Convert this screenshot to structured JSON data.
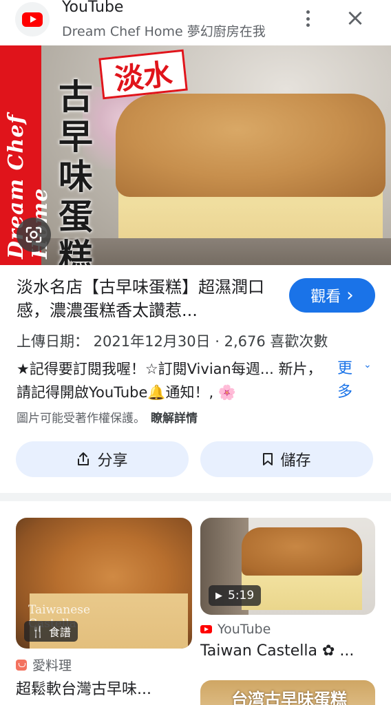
{
  "header": {
    "app_name": "YouTube",
    "channel": "Dream Chef Home 夢幻廚房在我",
    "icons": [
      "youtube-logo-icon",
      "more-vert-icon",
      "close-icon"
    ],
    "close_glyph": "×"
  },
  "hero": {
    "vertical_brand": "Dream Chef Home",
    "stamp": "淡水",
    "overlay_title": "古早味蛋糕",
    "lens_icon": "lens-icon"
  },
  "video": {
    "title": "淡水名店【古早味蛋糕】超濕潤口感，濃濃蛋糕香太讚惹...",
    "watch_label": "觀看",
    "watch_chevron": "›",
    "meta": "上傳日期： 2021年12月30日 · 2,676 喜歡次數",
    "description": "★記得要訂閱我喔！☆訂閱Vivian每週... 新片，請記得開啟YouTube🔔通知！, 🌸",
    "more_label": "更多",
    "more_chevron": "⌄",
    "copyright": "圖片可能受著作權保護。",
    "learn_more": "瞭解詳情"
  },
  "actions": {
    "share_label": "分享",
    "save_label": "儲存"
  },
  "related": [
    {
      "badge": "食譜",
      "watermark": "Taiwanese Castella",
      "source": "愛料理",
      "title": "超鬆軟台灣古早味..."
    },
    {
      "duration": "5:19",
      "source": "YouTube",
      "title": "Taiwan Castella ✿ ..."
    },
    {
      "overlay_text": "台湾古早味蛋糕"
    }
  ],
  "colors": {
    "accent": "#1a73e8",
    "pill_bg": "#e8f0fe",
    "brand_red": "#e0141b",
    "youtube_red": "#ff0000"
  }
}
